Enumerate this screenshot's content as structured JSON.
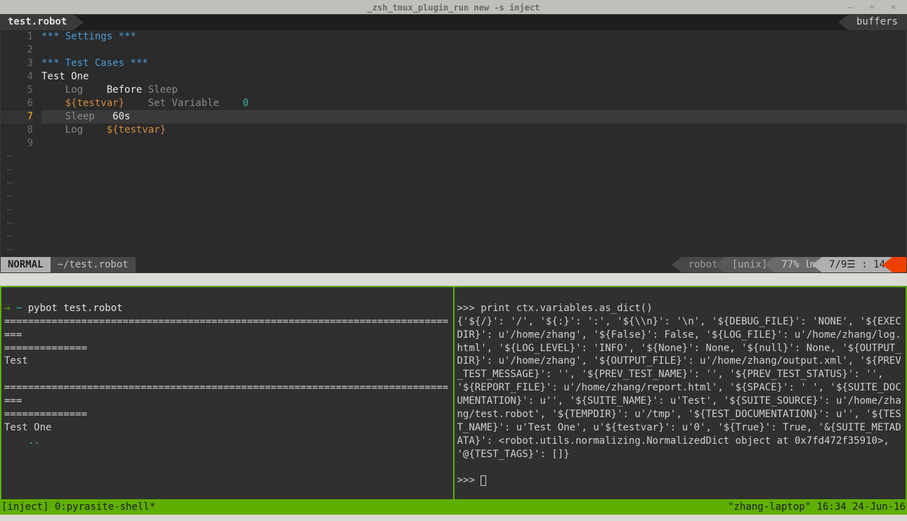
{
  "window": {
    "title": "_zsh_tmux_plugin_run new -s inject",
    "controls": "— + ×"
  },
  "tabs": {
    "current": "test.robot",
    "right": "buffers"
  },
  "code": {
    "lines": [
      {
        "n": 1,
        "tokens": [
          [
            "blue",
            "*** Settings ***"
          ]
        ]
      },
      {
        "n": 2,
        "tokens": []
      },
      {
        "n": 3,
        "tokens": [
          [
            "blue",
            "*** Test Cases ***"
          ]
        ]
      },
      {
        "n": 4,
        "tokens": [
          [
            "white",
            "Test One"
          ]
        ]
      },
      {
        "n": 5,
        "tokens": [
          [
            "plain",
            "    "
          ],
          [
            "kw",
            "Log"
          ],
          [
            "plain",
            "    "
          ],
          [
            "white",
            "Before"
          ],
          [
            "plain",
            " "
          ],
          [
            "kw",
            "Sleep"
          ]
        ]
      },
      {
        "n": 6,
        "tokens": [
          [
            "plain",
            "    "
          ],
          [
            "orange",
            "${testvar}"
          ],
          [
            "plain",
            "    "
          ],
          [
            "kw",
            "Set Variable"
          ],
          [
            "plain",
            "    "
          ],
          [
            "teal",
            "0"
          ]
        ]
      },
      {
        "n": 7,
        "current": true,
        "tokens": [
          [
            "plain",
            "    "
          ],
          [
            "kw",
            "Sleep"
          ],
          [
            "plain",
            "   "
          ],
          [
            "white",
            "60s"
          ]
        ]
      },
      {
        "n": 8,
        "tokens": [
          [
            "plain",
            "    "
          ],
          [
            "kw",
            "Log"
          ],
          [
            "plain",
            "    "
          ],
          [
            "orange",
            "${testvar}"
          ]
        ]
      },
      {
        "n": 9,
        "tokens": []
      }
    ],
    "tildes": 8
  },
  "statusline": {
    "mode": "NORMAL",
    "file": "~/test.robot",
    "filetype": "robot",
    "encoding": "[unix]",
    "percent": "77% ㏑",
    "position": "7/9☰ : 14"
  },
  "pane_left": {
    "prompt_arrow": "→ ",
    "prompt_tilde": "~ ",
    "command": "pybot test.robot",
    "sep_long": "==============================================================================",
    "sep_short": "==============",
    "suite": "Test",
    "test": "Test One",
    "dots": "    .."
  },
  "pane_right": {
    "prompt": ">>> ",
    "cmd": "print ctx.variables.as_dict()",
    "output": "{'${/}': '/', '${:}': ':', '${\\\\n}': '\\n', '${DEBUG_FILE}': 'NONE', '${EXECDIR}': u'/home/zhang', '${False}': False, '${LOG_FILE}': u'/home/zhang/log.html', '${LOG_LEVEL}': 'INFO', '${None}': None, '${null}': None, '${OUTPUT_DIR}': u'/home/zhang', '${OUTPUT_FILE}': u'/home/zhang/output.xml', '${PREV_TEST_MESSAGE}': '', '${PREV_TEST_NAME}': '', '${PREV_TEST_STATUS}': '', '${REPORT_FILE}': u'/home/zhang/report.html', '${SPACE}': ' ', '${SUITE_DOCUMENTATION}': u'', '${SUITE_NAME}': u'Test', '${SUITE_SOURCE}': u'/home/zhang/test.robot', '${TEMPDIR}': u'/tmp', '${TEST_DOCUMENTATION}': u'', '${TEST_NAME}': u'Test One', u'${testvar}': u'0', '${True}': True, '&{SUITE_METADATA}': <robot.utils.normalizing.NormalizedDict object at 0x7fd472f35910>, '@{TEST_TAGS}': []}",
    "prompt2": ">>> "
  },
  "tmux": {
    "left": "[inject] 0:pyrasite-shell*",
    "right": "\"zhang-laptop\" 16:34 24-Jun-16"
  }
}
